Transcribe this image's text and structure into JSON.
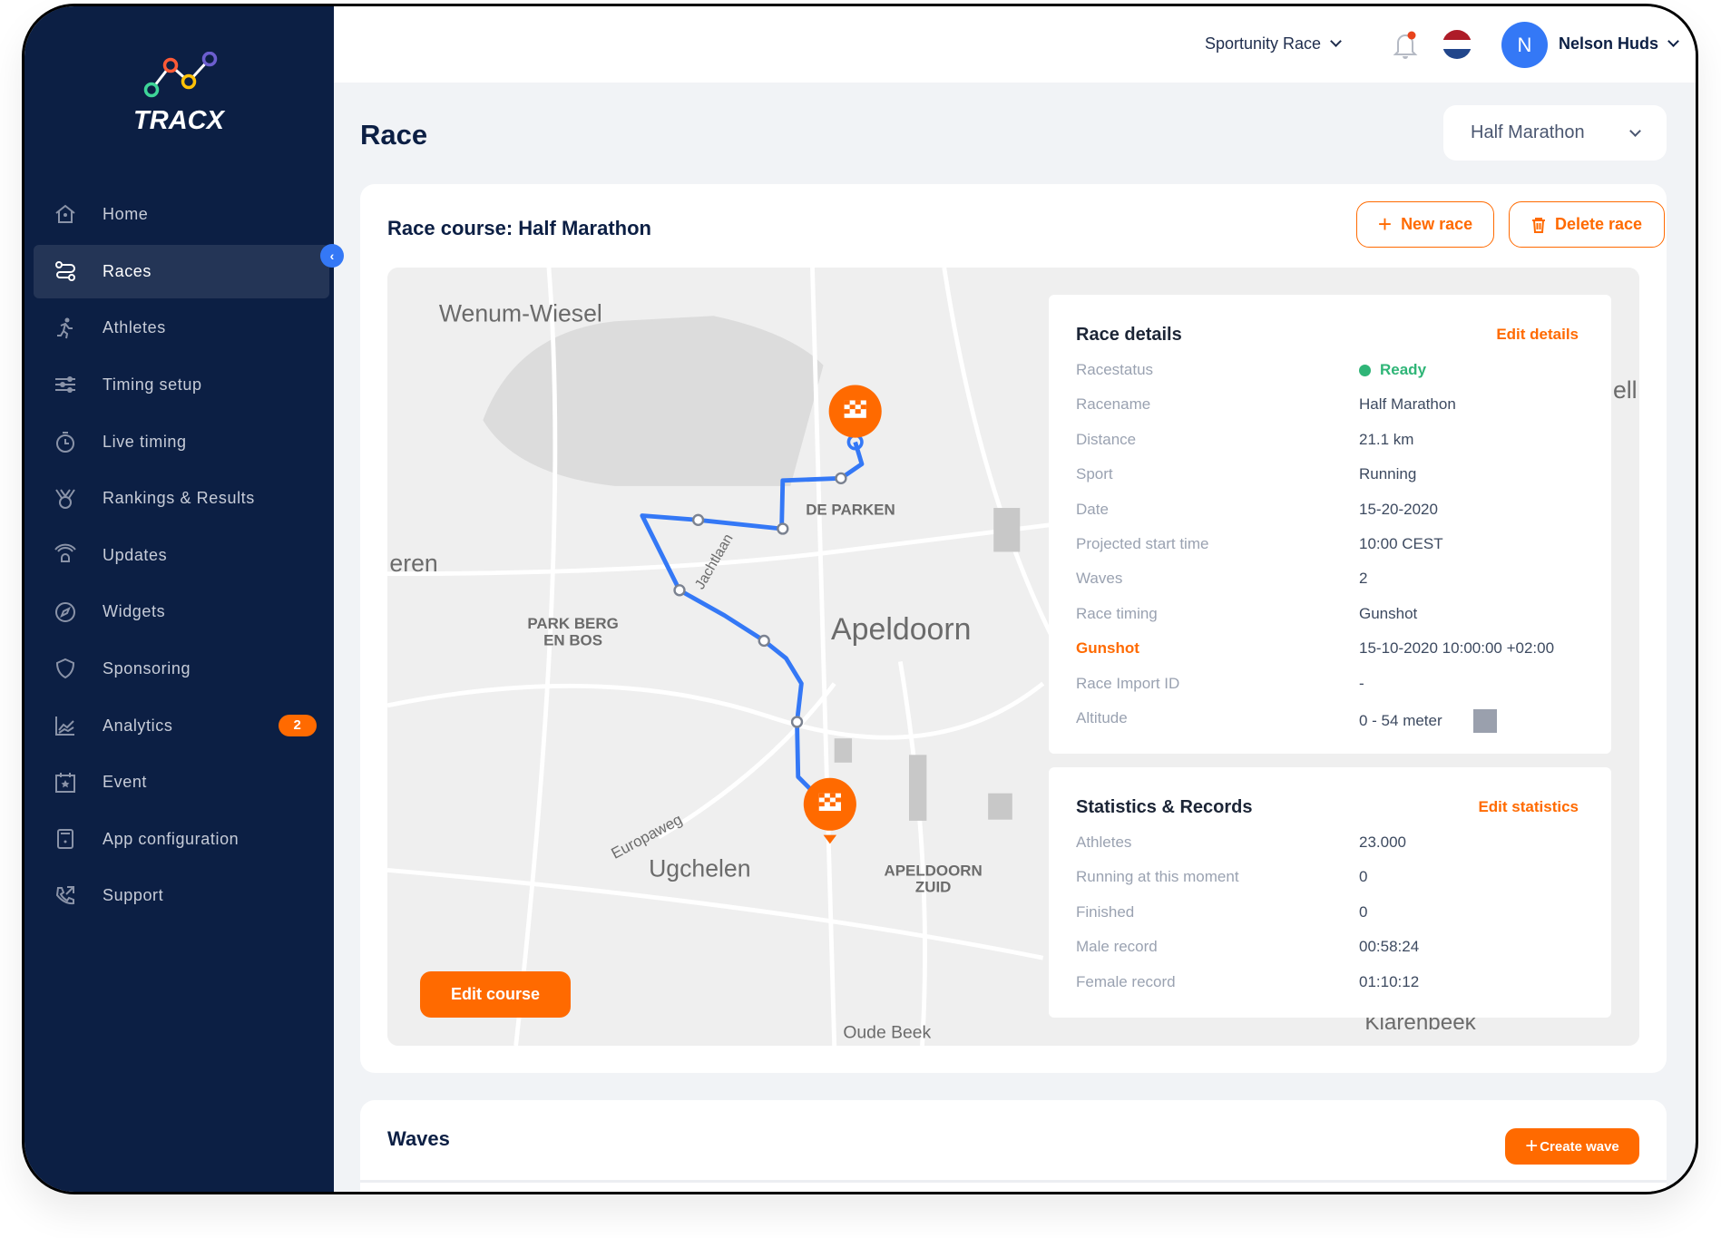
{
  "brand": {
    "name": "TRACX",
    "colors": {
      "sidebar": "#0c1f44",
      "accent": "#ff6a00",
      "primary": "#3478f6",
      "ready": "#2fb577"
    }
  },
  "sidebar": {
    "items": [
      {
        "label": "Home",
        "icon": "home-icon"
      },
      {
        "label": "Races",
        "icon": "route-icon",
        "active": true
      },
      {
        "label": "Athletes",
        "icon": "runner-icon"
      },
      {
        "label": "Timing setup",
        "icon": "sliders-icon"
      },
      {
        "label": "Live timing",
        "icon": "stopwatch-icon"
      },
      {
        "label": "Rankings & Results",
        "icon": "medal-icon"
      },
      {
        "label": "Updates",
        "icon": "broadcast-icon"
      },
      {
        "label": "Widgets",
        "icon": "compass-icon"
      },
      {
        "label": "Sponsoring",
        "icon": "shield-icon"
      },
      {
        "label": "Analytics",
        "icon": "chart-icon",
        "badge": "2"
      },
      {
        "label": "Event",
        "icon": "calendar-star-icon"
      },
      {
        "label": "App configuration",
        "icon": "tablet-icon"
      },
      {
        "label": "Support",
        "icon": "phone-icon"
      }
    ]
  },
  "topbar": {
    "organization": "Sportunity Race",
    "user_initial": "N",
    "user_name": "Nelson Huds"
  },
  "page": {
    "title": "Race",
    "race_select": "Half Marathon"
  },
  "course": {
    "title": "Race course: Half Marathon",
    "new_race": "New race",
    "delete_race": "Delete race",
    "edit_course": "Edit course",
    "map_labels": [
      "Wenum-Wiesel",
      "eren",
      "DE PARKEN",
      "Jachtlaan",
      "PARK BERG",
      "EN BOS",
      "Apeldoorn",
      "Europaweg",
      "Ugchelen",
      "APELDOORN",
      "ZUID",
      "Oude Beek",
      "Klarenbeek",
      "ell"
    ]
  },
  "details": {
    "title": "Race details",
    "edit": "Edit details",
    "rows": [
      {
        "label": "Racestatus",
        "value": "Ready"
      },
      {
        "label": "Racename",
        "value": "Half Marathon"
      },
      {
        "label": "Distance",
        "value": "21.1 km"
      },
      {
        "label": "Sport",
        "value": "Running"
      },
      {
        "label": "Date",
        "value": "15-20-2020"
      },
      {
        "label": "Projected start time",
        "value": "10:00 CEST"
      },
      {
        "label": "Waves",
        "value": "2"
      },
      {
        "label": "Race timing",
        "value": "Gunshot"
      },
      {
        "label": "Gunshot",
        "value": "15-10-2020 10:00:00 +02:00"
      },
      {
        "label": "Race Import ID",
        "value": "-"
      },
      {
        "label": "Altitude",
        "value": "0 - 54 meter"
      }
    ]
  },
  "stats": {
    "title": "Statistics & Records",
    "edit": "Edit statistics",
    "rows": [
      {
        "label": "Athletes",
        "value": "23.000"
      },
      {
        "label": "Running at this moment",
        "value": "0"
      },
      {
        "label": "Finished",
        "value": "0"
      },
      {
        "label": "Male record",
        "value": "00:58:24"
      },
      {
        "label": "Female record",
        "value": "01:10:12"
      }
    ]
  },
  "waves": {
    "title": "Waves",
    "create": "Create wave"
  }
}
